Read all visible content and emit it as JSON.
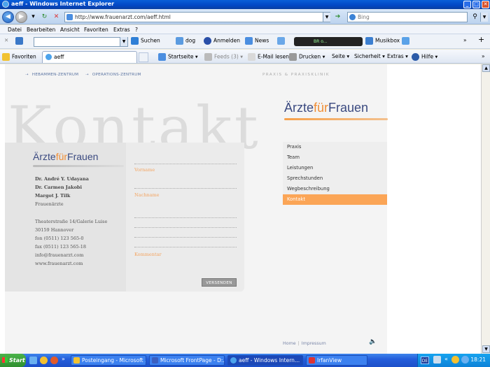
{
  "window": {
    "title": "aeff - Windows Internet Explorer",
    "buttons": {
      "minimize": "_",
      "maximize": "□",
      "close": "✕"
    }
  },
  "address_bar": {
    "url": "http://www.frauenarzt.com/aeff.html",
    "search_placeholder": "Bing"
  },
  "menu": [
    "Datei",
    "Bearbeiten",
    "Ansicht",
    "Favoriten",
    "Extras",
    "?"
  ],
  "toolbar": {
    "suchen": "Suchen",
    "dog": "dog",
    "anmelden": "Anmelden",
    "news": "News",
    "player_text": "BR o...",
    "musikbox": "Musikbox"
  },
  "favorites_bar": {
    "favoriten": "Favoriten",
    "tab_title": "aeff",
    "startseite": "Startseite",
    "feeds": "Feeds (3)",
    "email": "E-Mail lesen",
    "drucken": "Drucken",
    "seite": "Seite",
    "sicherheit": "Sicherheit",
    "extras": "Extras",
    "hilfe": "Hilfe"
  },
  "site": {
    "top_links": [
      "HEBAMMEN-ZENTRUM",
      "OPERATIONS-ZENTRUM"
    ],
    "praxis_label": "PRAXIS & PRAXISKLINIK",
    "bg_word": "Kontakt",
    "logo": {
      "part1": "Ärzte",
      "part2": "für",
      "part3": "Frauen"
    },
    "doctors": [
      "Dr. André Y. Udayana",
      "Dr. Carmen Jakobi",
      "Margot J. Tilk"
    ],
    "profession": "Frauenärzte",
    "address": [
      "Theaterstraße 14/Galerie Luise",
      "30159 Hannover",
      "fon (0511) 123 565-0",
      "fax (0511) 123 565-18",
      "info@frauenarzt.com",
      "www.frauenarzt.com"
    ],
    "form": {
      "vorname": "Vorname",
      "nachname": "Nachname",
      "kommentar": "Kommentar",
      "send": "VERSENDEN"
    },
    "nav": [
      {
        "label": "Praxis",
        "active": false
      },
      {
        "label": "Team",
        "active": false
      },
      {
        "label": "Leistungen",
        "active": false
      },
      {
        "label": "Sprechstunden",
        "active": false
      },
      {
        "label": "Wegbeschreibung",
        "active": false
      },
      {
        "label": "Kontakt",
        "active": true
      }
    ],
    "footer": {
      "home": "Home",
      "separator": "|",
      "impressum": "Impressum"
    }
  },
  "taskbar": {
    "start": "Start",
    "tasks": [
      "Posteingang - Microsoft ...",
      "Microsoft FrontPage - D:...",
      "aeff - Windows Intern...",
      "IrfanView"
    ],
    "language": "DE",
    "clock": "18:21"
  },
  "colors": {
    "accent_orange": "#fba556",
    "logo_blue": "#3b4a80",
    "xp_blue": "#245edb"
  }
}
